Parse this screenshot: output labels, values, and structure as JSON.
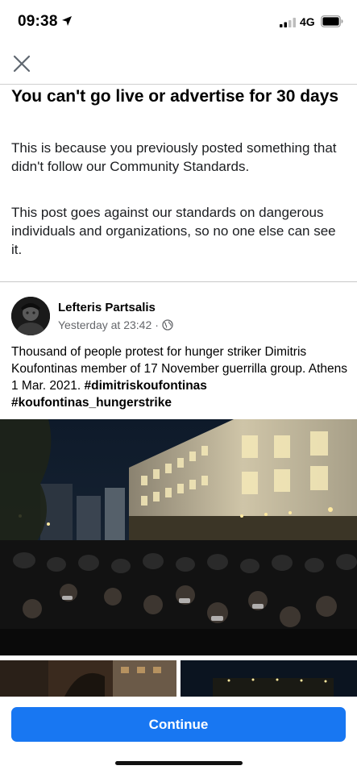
{
  "status_bar": {
    "time": "09:38",
    "network": "4G",
    "icons": [
      "location-arrow-icon",
      "signal-icon",
      "battery-icon"
    ]
  },
  "dialog": {
    "close_icon": "close-icon",
    "title": "You can't go live or advertise for 30 days",
    "paragraph_1": "This is because you previously posted something that didn't follow our Community Standards.",
    "paragraph_2": "This post goes against our standards on dangerous individuals and organizations, so no one else can see it."
  },
  "post": {
    "author": "Lefteris Partsalis",
    "timestamp": "Yesterday at 23:42",
    "separator": "·",
    "privacy_icon": "globe-icon",
    "text": "Thousand of people protest for hunger striker Dimitris Koufontinas member of 17 November guerrilla group. Athens 1 Mar. 2021.",
    "hashtags": [
      "#dimitriskoufontinas",
      "#koufontinas_hungerstrike"
    ]
  },
  "footer": {
    "continue_label": "Continue"
  },
  "colors": {
    "accent": "#1877f2",
    "secondary_text": "#65676b",
    "divider": "#d0d0d0"
  }
}
